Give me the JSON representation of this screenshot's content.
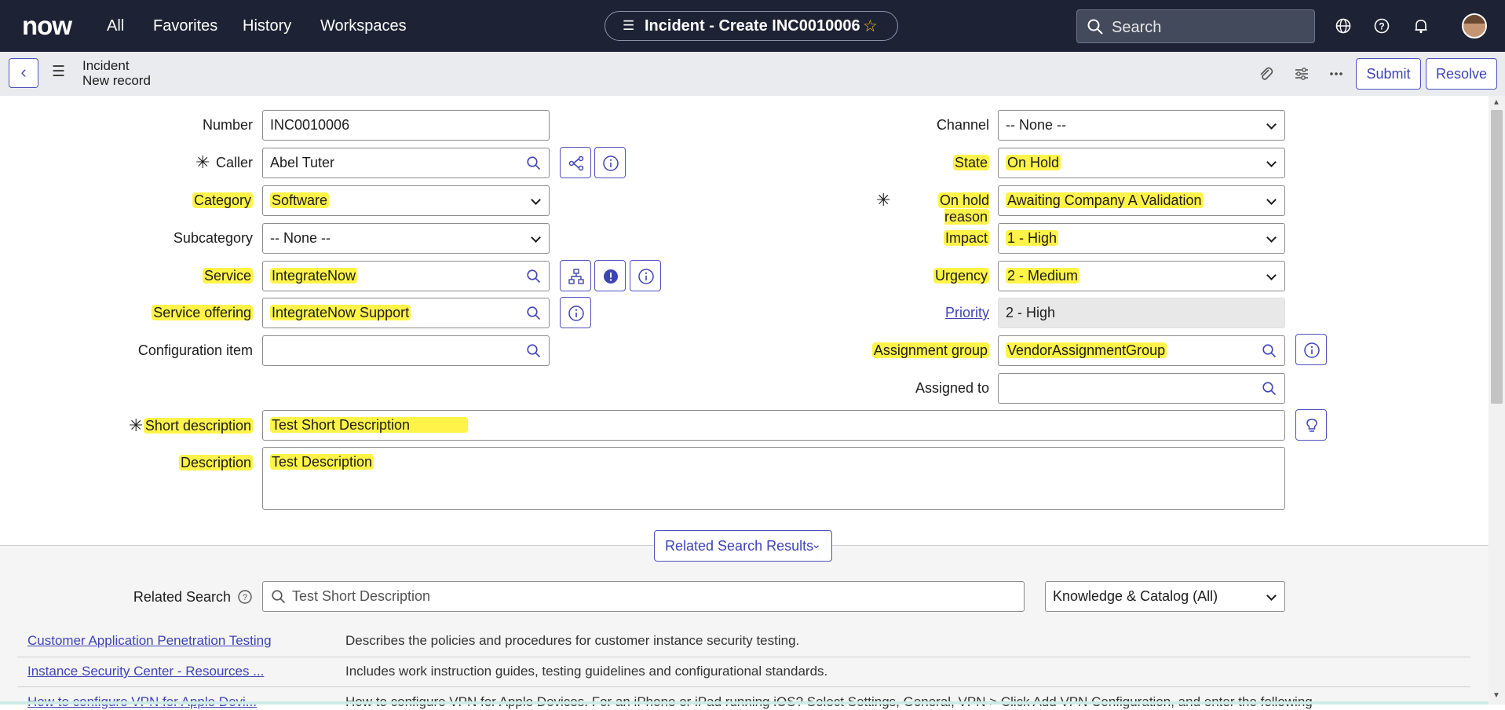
{
  "topnav": {
    "logo": "now",
    "links": [
      "All",
      "Favorites",
      "History",
      "Workspaces"
    ],
    "record_title": "Incident - Create INC0010006",
    "search_placeholder": "Search"
  },
  "header": {
    "record_type": "Incident",
    "record_state": "New record",
    "submit_label": "Submit",
    "resolve_label": "Resolve"
  },
  "form": {
    "left": {
      "number": {
        "label": "Number",
        "value": "INC0010006"
      },
      "caller": {
        "label": "Caller",
        "value": "Abel Tuter"
      },
      "category": {
        "label": "Category",
        "value": "Software"
      },
      "subcategory": {
        "label": "Subcategory",
        "value": "-- None --"
      },
      "service": {
        "label": "Service",
        "value": "IntegrateNow"
      },
      "service_offering": {
        "label": "Service offering",
        "value": "IntegrateNow Support"
      },
      "configuration_item": {
        "label": "Configuration item",
        "value": ""
      }
    },
    "right": {
      "channel": {
        "label": "Channel",
        "value": "-- None --"
      },
      "state": {
        "label": "State",
        "value": "On Hold"
      },
      "on_hold_reason": {
        "label": "On hold reason",
        "value": "Awaiting Company A Validation"
      },
      "impact": {
        "label": "Impact",
        "value": "1 - High"
      },
      "urgency": {
        "label": "Urgency",
        "value": "2 - Medium"
      },
      "priority": {
        "label": "Priority",
        "value": "2 - High"
      },
      "assignment_group": {
        "label": "Assignment group",
        "value": "VendorAssignmentGroup"
      },
      "assigned_to": {
        "label": "Assigned to",
        "value": ""
      }
    },
    "short_description": {
      "label": "Short description",
      "value": "Test Short Description"
    },
    "description": {
      "label": "Description",
      "value": "Test Description"
    }
  },
  "related": {
    "button_label": "Related Search Results",
    "search_label": "Related Search",
    "search_value": "Test Short Description",
    "scope_value": "Knowledge & Catalog (All)",
    "results": [
      {
        "title": "Customer Application Penetration Testing",
        "desc": "Describes the policies and procedures for customer instance security testing."
      },
      {
        "title": "Instance Security Center - Resources ...",
        "desc": "Includes work instruction guides, testing guidelines and configurational standards."
      },
      {
        "title": "How to configure VPN for Apple Devi...",
        "desc": "How to configure VPN for Apple Devices. For an iPhone or iPad running iOS? Select Settings, General, VPN > Click Add VPN Configuration, and enter the following"
      }
    ]
  },
  "colors": {
    "nav_bg": "#1d2334",
    "accent": "#3f44b5",
    "highlight": "#fff34a"
  }
}
